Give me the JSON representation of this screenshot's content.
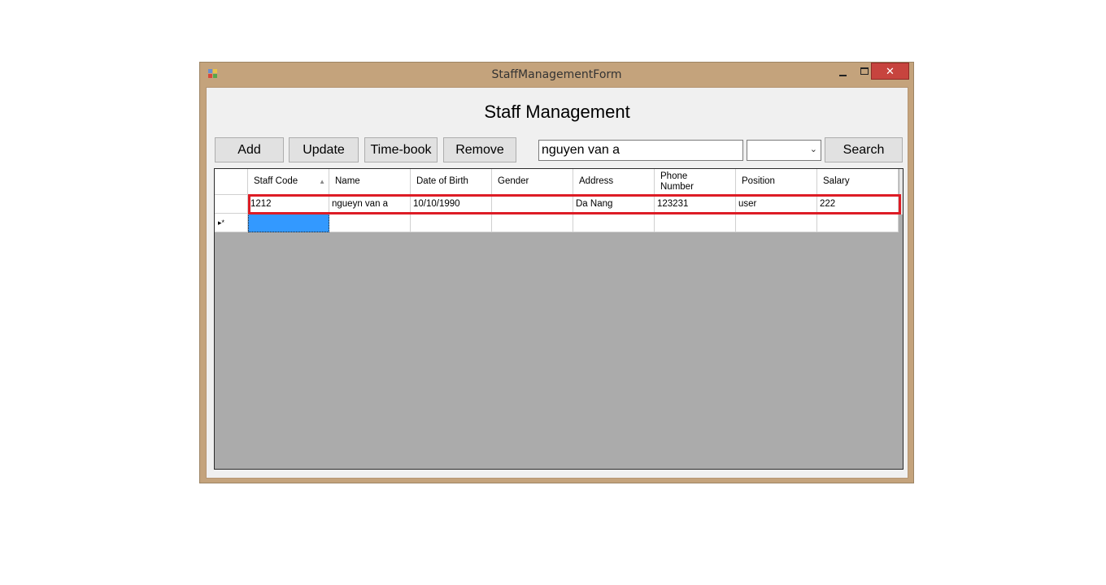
{
  "window": {
    "title": "StaffManagementForm",
    "close_glyph": "✕"
  },
  "heading": "Staff Management",
  "toolbar": {
    "add_label": "Add",
    "update_label": "Update",
    "timebook_label": "Time-book",
    "remove_label": "Remove",
    "search_value": "nguyen van a",
    "filter_value": "",
    "search_label": "Search"
  },
  "grid": {
    "columns": [
      "Staff Code",
      "Name",
      "Date of Birth",
      "Gender",
      "Address",
      "Phone Number",
      "Position",
      "Salary"
    ],
    "sorted_column": "Staff Code",
    "rows": [
      [
        "1212",
        "ngueyn van a",
        "10/10/1990",
        "",
        "Da Nang",
        "123231",
        "user",
        "222"
      ]
    ],
    "new_row_marker": "▸*"
  },
  "colors": {
    "window_border": "#c4a37c",
    "client_bg": "#f0f0f0",
    "grid_bg": "#ababab",
    "selection": "#3399ff",
    "highlight_outline": "#dd1c25",
    "close_button": "#c7443e"
  }
}
